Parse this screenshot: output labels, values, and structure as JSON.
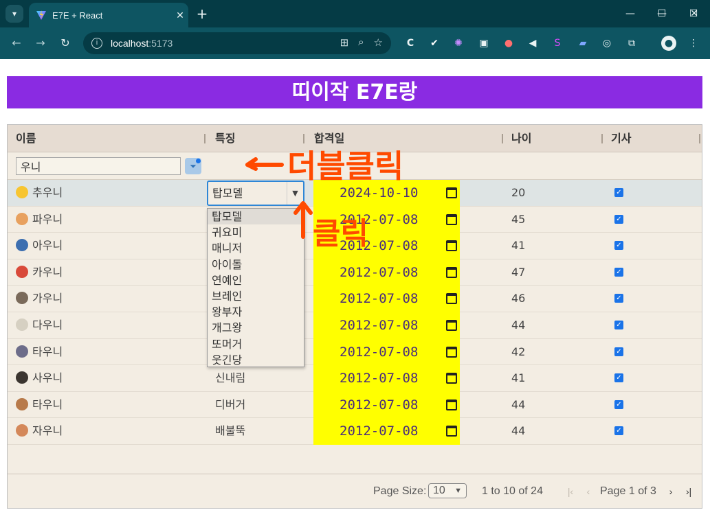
{
  "browser": {
    "tab_title": "E7E + React",
    "url_host": "localhost",
    "url_port": ":5173"
  },
  "page": {
    "banner_title": "띠이작 E7E랑"
  },
  "grid": {
    "columns": [
      "이름",
      "특징",
      "합격일",
      "나이",
      "기사"
    ],
    "filter_value": "우니",
    "rows": [
      {
        "name": "추우니",
        "trait": "탑모델",
        "date": "2024-10-10",
        "age": "20",
        "checked": true,
        "emoji_color": "#f7c531"
      },
      {
        "name": "파우니",
        "trait": "",
        "date": "2012-07-08",
        "age": "45",
        "checked": true,
        "emoji_color": "#e8a15f"
      },
      {
        "name": "아우니",
        "trait": "",
        "date": "2012-07-08",
        "age": "41",
        "checked": true,
        "emoji_color": "#3d6fb0"
      },
      {
        "name": "카우니",
        "trait": "",
        "date": "2012-07-08",
        "age": "47",
        "checked": true,
        "emoji_color": "#d94a3a"
      },
      {
        "name": "가우니",
        "trait": "",
        "date": "2012-07-08",
        "age": "46",
        "checked": true,
        "emoji_color": "#7a6a5a"
      },
      {
        "name": "다우니",
        "trait": "",
        "date": "2012-07-08",
        "age": "44",
        "checked": true,
        "emoji_color": "#d6d0c2"
      },
      {
        "name": "타우니",
        "trait": "",
        "date": "2012-07-08",
        "age": "42",
        "checked": true,
        "emoji_color": "#6d6d8a"
      },
      {
        "name": "사우니",
        "trait": "신내림",
        "date": "2012-07-08",
        "age": "41",
        "checked": true,
        "emoji_color": "#3b3530"
      },
      {
        "name": "타우니",
        "trait": "디버거",
        "date": "2012-07-08",
        "age": "44",
        "checked": true,
        "emoji_color": "#b87a4a"
      },
      {
        "name": "자우니",
        "trait": "배불뚝",
        "date": "2012-07-08",
        "age": "44",
        "checked": true,
        "emoji_color": "#d4885a"
      }
    ],
    "dropdown_options": [
      "탑모델",
      "귀요미",
      "매니저",
      "아이돌",
      "연예인",
      "브레인",
      "왕부자",
      "개그왕",
      "또머거",
      "웃긴당"
    ]
  },
  "pagination": {
    "page_size_label": "Page Size:",
    "page_size_value": "10",
    "range_text": "1 to 10 of 24",
    "page_word": "Page",
    "current_page": "1",
    "of_word": "of",
    "total_pages": "3"
  },
  "annotations": {
    "double_click": "더블클릭",
    "click": "클릭",
    "color": "#ff4a00"
  }
}
